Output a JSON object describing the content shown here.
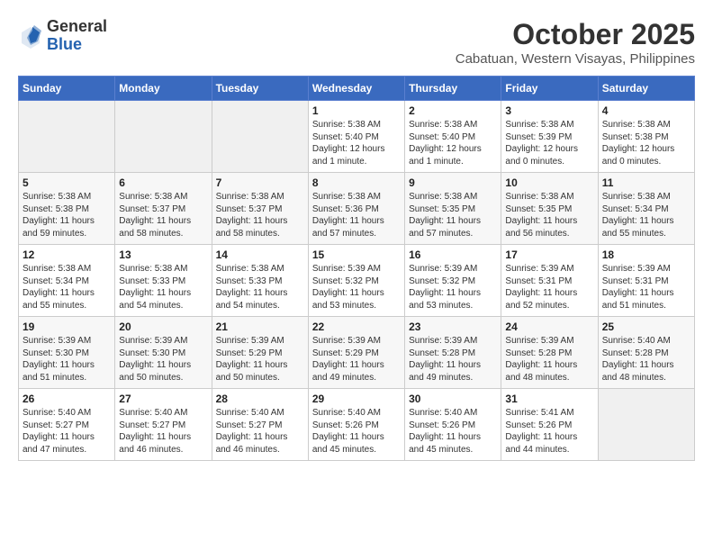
{
  "header": {
    "logo_general": "General",
    "logo_blue": "Blue",
    "month_title": "October 2025",
    "subtitle": "Cabatuan, Western Visayas, Philippines"
  },
  "weekdays": [
    "Sunday",
    "Monday",
    "Tuesday",
    "Wednesday",
    "Thursday",
    "Friday",
    "Saturday"
  ],
  "weeks": [
    [
      {
        "day": "",
        "info": ""
      },
      {
        "day": "",
        "info": ""
      },
      {
        "day": "",
        "info": ""
      },
      {
        "day": "1",
        "info": "Sunrise: 5:38 AM\nSunset: 5:40 PM\nDaylight: 12 hours\nand 1 minute."
      },
      {
        "day": "2",
        "info": "Sunrise: 5:38 AM\nSunset: 5:40 PM\nDaylight: 12 hours\nand 1 minute."
      },
      {
        "day": "3",
        "info": "Sunrise: 5:38 AM\nSunset: 5:39 PM\nDaylight: 12 hours\nand 0 minutes."
      },
      {
        "day": "4",
        "info": "Sunrise: 5:38 AM\nSunset: 5:38 PM\nDaylight: 12 hours\nand 0 minutes."
      }
    ],
    [
      {
        "day": "5",
        "info": "Sunrise: 5:38 AM\nSunset: 5:38 PM\nDaylight: 11 hours\nand 59 minutes."
      },
      {
        "day": "6",
        "info": "Sunrise: 5:38 AM\nSunset: 5:37 PM\nDaylight: 11 hours\nand 58 minutes."
      },
      {
        "day": "7",
        "info": "Sunrise: 5:38 AM\nSunset: 5:37 PM\nDaylight: 11 hours\nand 58 minutes."
      },
      {
        "day": "8",
        "info": "Sunrise: 5:38 AM\nSunset: 5:36 PM\nDaylight: 11 hours\nand 57 minutes."
      },
      {
        "day": "9",
        "info": "Sunrise: 5:38 AM\nSunset: 5:35 PM\nDaylight: 11 hours\nand 57 minutes."
      },
      {
        "day": "10",
        "info": "Sunrise: 5:38 AM\nSunset: 5:35 PM\nDaylight: 11 hours\nand 56 minutes."
      },
      {
        "day": "11",
        "info": "Sunrise: 5:38 AM\nSunset: 5:34 PM\nDaylight: 11 hours\nand 55 minutes."
      }
    ],
    [
      {
        "day": "12",
        "info": "Sunrise: 5:38 AM\nSunset: 5:34 PM\nDaylight: 11 hours\nand 55 minutes."
      },
      {
        "day": "13",
        "info": "Sunrise: 5:38 AM\nSunset: 5:33 PM\nDaylight: 11 hours\nand 54 minutes."
      },
      {
        "day": "14",
        "info": "Sunrise: 5:38 AM\nSunset: 5:33 PM\nDaylight: 11 hours\nand 54 minutes."
      },
      {
        "day": "15",
        "info": "Sunrise: 5:39 AM\nSunset: 5:32 PM\nDaylight: 11 hours\nand 53 minutes."
      },
      {
        "day": "16",
        "info": "Sunrise: 5:39 AM\nSunset: 5:32 PM\nDaylight: 11 hours\nand 53 minutes."
      },
      {
        "day": "17",
        "info": "Sunrise: 5:39 AM\nSunset: 5:31 PM\nDaylight: 11 hours\nand 52 minutes."
      },
      {
        "day": "18",
        "info": "Sunrise: 5:39 AM\nSunset: 5:31 PM\nDaylight: 11 hours\nand 51 minutes."
      }
    ],
    [
      {
        "day": "19",
        "info": "Sunrise: 5:39 AM\nSunset: 5:30 PM\nDaylight: 11 hours\nand 51 minutes."
      },
      {
        "day": "20",
        "info": "Sunrise: 5:39 AM\nSunset: 5:30 PM\nDaylight: 11 hours\nand 50 minutes."
      },
      {
        "day": "21",
        "info": "Sunrise: 5:39 AM\nSunset: 5:29 PM\nDaylight: 11 hours\nand 50 minutes."
      },
      {
        "day": "22",
        "info": "Sunrise: 5:39 AM\nSunset: 5:29 PM\nDaylight: 11 hours\nand 49 minutes."
      },
      {
        "day": "23",
        "info": "Sunrise: 5:39 AM\nSunset: 5:28 PM\nDaylight: 11 hours\nand 49 minutes."
      },
      {
        "day": "24",
        "info": "Sunrise: 5:39 AM\nSunset: 5:28 PM\nDaylight: 11 hours\nand 48 minutes."
      },
      {
        "day": "25",
        "info": "Sunrise: 5:40 AM\nSunset: 5:28 PM\nDaylight: 11 hours\nand 48 minutes."
      }
    ],
    [
      {
        "day": "26",
        "info": "Sunrise: 5:40 AM\nSunset: 5:27 PM\nDaylight: 11 hours\nand 47 minutes."
      },
      {
        "day": "27",
        "info": "Sunrise: 5:40 AM\nSunset: 5:27 PM\nDaylight: 11 hours\nand 46 minutes."
      },
      {
        "day": "28",
        "info": "Sunrise: 5:40 AM\nSunset: 5:27 PM\nDaylight: 11 hours\nand 46 minutes."
      },
      {
        "day": "29",
        "info": "Sunrise: 5:40 AM\nSunset: 5:26 PM\nDaylight: 11 hours\nand 45 minutes."
      },
      {
        "day": "30",
        "info": "Sunrise: 5:40 AM\nSunset: 5:26 PM\nDaylight: 11 hours\nand 45 minutes."
      },
      {
        "day": "31",
        "info": "Sunrise: 5:41 AM\nSunset: 5:26 PM\nDaylight: 11 hours\nand 44 minutes."
      },
      {
        "day": "",
        "info": ""
      }
    ]
  ]
}
